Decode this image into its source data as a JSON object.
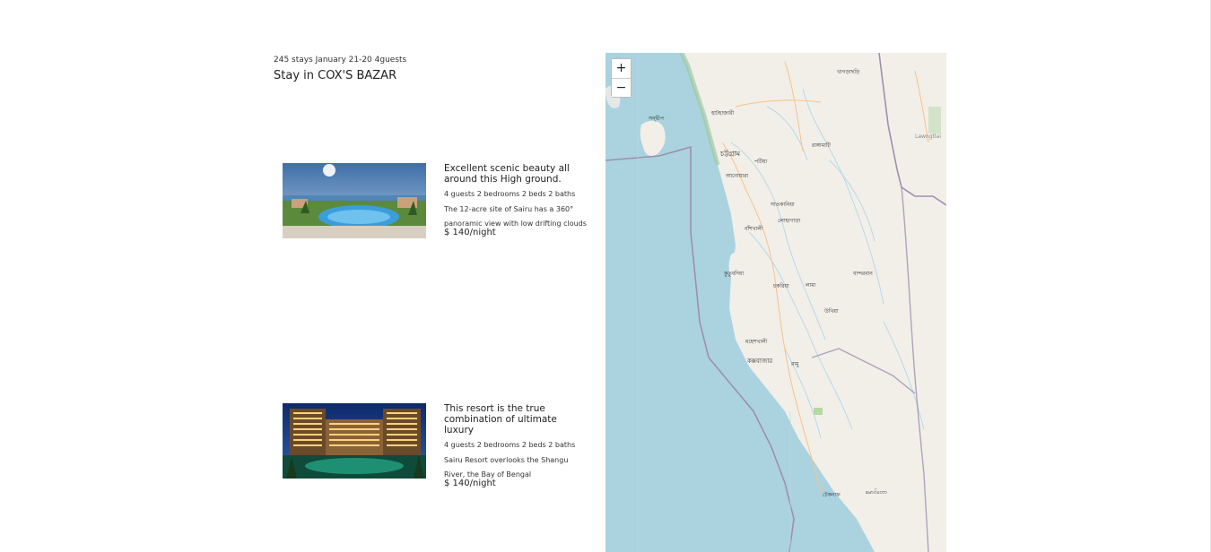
{
  "header": {
    "summary": "245 stays January 21-20 4guests",
    "title": "Stay in COX'S BAZAR"
  },
  "listings": [
    {
      "name": "Excellent scenic beauty all around this High ground.",
      "specs": "4 guests 2 bedrooms 2 beds 2 baths",
      "description": "The 12-acre site of Sairu has a 360° panoramic view with low drifting clouds",
      "price": "$ 140/night"
    },
    {
      "name": "This resort is the true combination of ultimate luxury",
      "specs": "4 guests 2 bedrooms 2 beds 2 baths",
      "description": "Sairu Resort overlooks the Shangu River, the Bay of Bengal",
      "price": "$ 140/night"
    }
  ],
  "map": {
    "zoom_in": "+",
    "zoom_out": "−",
    "labels": {
      "sandwip": "সন্দ্বীপ",
      "hathazari": "হাটহাজারী",
      "chattogram": "চট্টগ্রাম",
      "patiya": "পটিয়া",
      "anowara": "আনোয়ারা",
      "satkania": "সাতকানিয়া",
      "lohagara": "লোহাগাড়া",
      "banshkhali": "বাঁশখালী",
      "kutubdia": "কুতুবদিয়া",
      "chakaria": "চকরিয়া",
      "lama": "লামা",
      "rangamati": "রাঙ্গামাটি",
      "bandarban": "বান্দরবান",
      "maheshkhali": "মহেশখালী",
      "coxs_bazar": "কক্সবাজার",
      "ramu": "রামু",
      "ukhia": "উখিয়া",
      "teknaf": "টেকনাফ",
      "khagrachari": "খাগড়াছড়ি",
      "lawngtlai": "Lawngtlai",
      "maungdaw": "မောင်တော"
    },
    "colors": {
      "water": "#aad3df",
      "land": "#f2efe9",
      "border": "#9e8fb0",
      "road": "#f6c28a",
      "river": "#b5d9e8"
    }
  }
}
